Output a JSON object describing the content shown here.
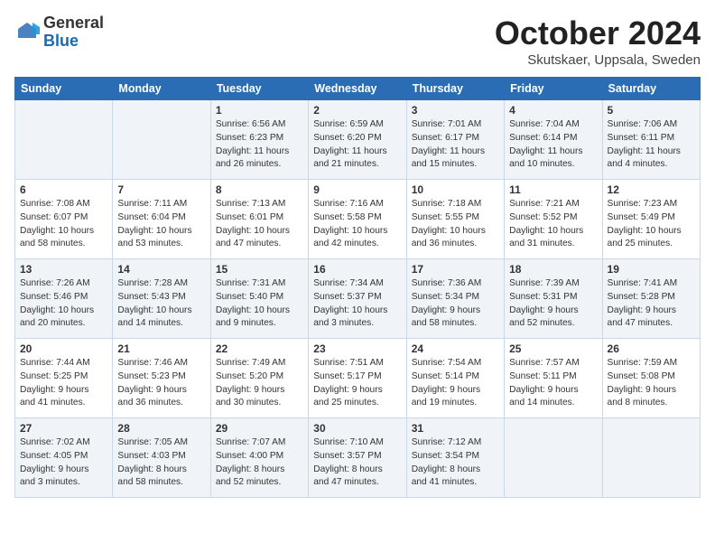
{
  "header": {
    "logo_general": "General",
    "logo_blue": "Blue",
    "month_title": "October 2024",
    "location": "Skutskaer, Uppsala, Sweden"
  },
  "days_of_week": [
    "Sunday",
    "Monday",
    "Tuesday",
    "Wednesday",
    "Thursday",
    "Friday",
    "Saturday"
  ],
  "weeks": [
    [
      {
        "day": "",
        "info": ""
      },
      {
        "day": "",
        "info": ""
      },
      {
        "day": "1",
        "info": "Sunrise: 6:56 AM\nSunset: 6:23 PM\nDaylight: 11 hours\nand 26 minutes."
      },
      {
        "day": "2",
        "info": "Sunrise: 6:59 AM\nSunset: 6:20 PM\nDaylight: 11 hours\nand 21 minutes."
      },
      {
        "day": "3",
        "info": "Sunrise: 7:01 AM\nSunset: 6:17 PM\nDaylight: 11 hours\nand 15 minutes."
      },
      {
        "day": "4",
        "info": "Sunrise: 7:04 AM\nSunset: 6:14 PM\nDaylight: 11 hours\nand 10 minutes."
      },
      {
        "day": "5",
        "info": "Sunrise: 7:06 AM\nSunset: 6:11 PM\nDaylight: 11 hours\nand 4 minutes."
      }
    ],
    [
      {
        "day": "6",
        "info": "Sunrise: 7:08 AM\nSunset: 6:07 PM\nDaylight: 10 hours\nand 58 minutes."
      },
      {
        "day": "7",
        "info": "Sunrise: 7:11 AM\nSunset: 6:04 PM\nDaylight: 10 hours\nand 53 minutes."
      },
      {
        "day": "8",
        "info": "Sunrise: 7:13 AM\nSunset: 6:01 PM\nDaylight: 10 hours\nand 47 minutes."
      },
      {
        "day": "9",
        "info": "Sunrise: 7:16 AM\nSunset: 5:58 PM\nDaylight: 10 hours\nand 42 minutes."
      },
      {
        "day": "10",
        "info": "Sunrise: 7:18 AM\nSunset: 5:55 PM\nDaylight: 10 hours\nand 36 minutes."
      },
      {
        "day": "11",
        "info": "Sunrise: 7:21 AM\nSunset: 5:52 PM\nDaylight: 10 hours\nand 31 minutes."
      },
      {
        "day": "12",
        "info": "Sunrise: 7:23 AM\nSunset: 5:49 PM\nDaylight: 10 hours\nand 25 minutes."
      }
    ],
    [
      {
        "day": "13",
        "info": "Sunrise: 7:26 AM\nSunset: 5:46 PM\nDaylight: 10 hours\nand 20 minutes."
      },
      {
        "day": "14",
        "info": "Sunrise: 7:28 AM\nSunset: 5:43 PM\nDaylight: 10 hours\nand 14 minutes."
      },
      {
        "day": "15",
        "info": "Sunrise: 7:31 AM\nSunset: 5:40 PM\nDaylight: 10 hours\nand 9 minutes."
      },
      {
        "day": "16",
        "info": "Sunrise: 7:34 AM\nSunset: 5:37 PM\nDaylight: 10 hours\nand 3 minutes."
      },
      {
        "day": "17",
        "info": "Sunrise: 7:36 AM\nSunset: 5:34 PM\nDaylight: 9 hours\nand 58 minutes."
      },
      {
        "day": "18",
        "info": "Sunrise: 7:39 AM\nSunset: 5:31 PM\nDaylight: 9 hours\nand 52 minutes."
      },
      {
        "day": "19",
        "info": "Sunrise: 7:41 AM\nSunset: 5:28 PM\nDaylight: 9 hours\nand 47 minutes."
      }
    ],
    [
      {
        "day": "20",
        "info": "Sunrise: 7:44 AM\nSunset: 5:25 PM\nDaylight: 9 hours\nand 41 minutes."
      },
      {
        "day": "21",
        "info": "Sunrise: 7:46 AM\nSunset: 5:23 PM\nDaylight: 9 hours\nand 36 minutes."
      },
      {
        "day": "22",
        "info": "Sunrise: 7:49 AM\nSunset: 5:20 PM\nDaylight: 9 hours\nand 30 minutes."
      },
      {
        "day": "23",
        "info": "Sunrise: 7:51 AM\nSunset: 5:17 PM\nDaylight: 9 hours\nand 25 minutes."
      },
      {
        "day": "24",
        "info": "Sunrise: 7:54 AM\nSunset: 5:14 PM\nDaylight: 9 hours\nand 19 minutes."
      },
      {
        "day": "25",
        "info": "Sunrise: 7:57 AM\nSunset: 5:11 PM\nDaylight: 9 hours\nand 14 minutes."
      },
      {
        "day": "26",
        "info": "Sunrise: 7:59 AM\nSunset: 5:08 PM\nDaylight: 9 hours\nand 8 minutes."
      }
    ],
    [
      {
        "day": "27",
        "info": "Sunrise: 7:02 AM\nSunset: 4:05 PM\nDaylight: 9 hours\nand 3 minutes."
      },
      {
        "day": "28",
        "info": "Sunrise: 7:05 AM\nSunset: 4:03 PM\nDaylight: 8 hours\nand 58 minutes."
      },
      {
        "day": "29",
        "info": "Sunrise: 7:07 AM\nSunset: 4:00 PM\nDaylight: 8 hours\nand 52 minutes."
      },
      {
        "day": "30",
        "info": "Sunrise: 7:10 AM\nSunset: 3:57 PM\nDaylight: 8 hours\nand 47 minutes."
      },
      {
        "day": "31",
        "info": "Sunrise: 7:12 AM\nSunset: 3:54 PM\nDaylight: 8 hours\nand 41 minutes."
      },
      {
        "day": "",
        "info": ""
      },
      {
        "day": "",
        "info": ""
      }
    ]
  ]
}
